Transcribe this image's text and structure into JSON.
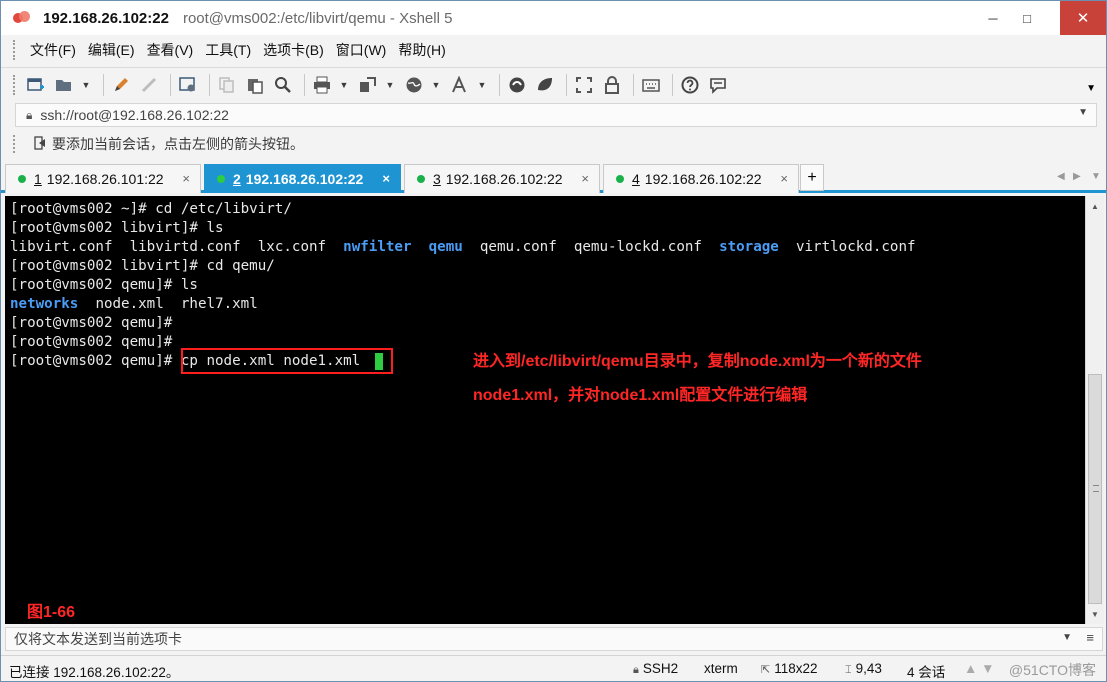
{
  "window": {
    "title_main": "192.168.26.102:22",
    "title_sub": "root@vms002:/etc/libvirt/qemu - Xshell 5",
    "minimize_glyph": "─",
    "maximize_glyph": "□",
    "close_glyph": "✕"
  },
  "menu": {
    "items": [
      "文件(F)",
      "编辑(E)",
      "查看(V)",
      "工具(T)",
      "选项卡(B)",
      "窗口(W)",
      "帮助(H)"
    ]
  },
  "toolbar": {
    "icons": [
      "new-session-icon",
      "open-folder-icon",
      "pencil-icon",
      "disconnect-icon",
      "properties-icon",
      "copy-icon",
      "paste-icon",
      "find-icon",
      "print-icon",
      "transfer-icon",
      "globe-icon",
      "font-icon",
      "xftp-icon",
      "xmanager-icon",
      "fullscreen-icon",
      "lock-icon",
      "keyboard-icon",
      "help-icon",
      "chat-icon"
    ]
  },
  "address": {
    "value": "ssh://root@192.168.26.102:22"
  },
  "hint": {
    "text": "要添加当前会话，点击左侧的箭头按钮。"
  },
  "tabs": [
    {
      "num": "1",
      "label": "192.168.26.101:22",
      "active": false
    },
    {
      "num": "2",
      "label": "192.168.26.102:22",
      "active": true
    },
    {
      "num": "3",
      "label": "192.168.26.102:22",
      "active": false
    },
    {
      "num": "4",
      "label": "192.168.26.102:22",
      "active": false
    }
  ],
  "tab_add": "+",
  "tab_close": "×",
  "terminal": {
    "l1": "[root@vms002 ~]# cd /etc/libvirt/",
    "l2": "[root@vms002 libvirt]# ls",
    "l3": {
      "f1": "libvirt.conf",
      "f2": "libvirtd.conf",
      "f3": "lxc.conf",
      "d1": "nwfilter",
      "d2": "qemu",
      "f4": "qemu.conf",
      "f5": "qemu-lockd.conf",
      "d3": "storage",
      "f6": "virtlockd.conf"
    },
    "l4": "[root@vms002 libvirt]# cd qemu/",
    "l5": "[root@vms002 qemu]# ls",
    "l6": {
      "d1": "networks",
      "f1": "node.xml",
      "f2": "rhel7.xml"
    },
    "l7": "[root@vms002 qemu]#",
    "l8": "[root@vms002 qemu]#",
    "l9_prompt": "[root@vms002 qemu]#",
    "l9_cmd": " cp node.xml node1.xml ",
    "annotation_line1": "进入到/etc/libvirt/qemu目录中，复制node.xml为一个新的文件",
    "annotation_line2": "node1.xml，并对node1.xml配置文件进行编辑",
    "figure_label": "图1-66"
  },
  "compose": {
    "placeholder": "仅将文本发送到当前选项卡"
  },
  "status": {
    "connected": "已连接 192.168.26.102:22。",
    "protocol": "SSH2",
    "terminal_type": "xterm",
    "size": "118x22",
    "cursor_pos": "9,43",
    "sessions": "4 会话",
    "watermark": "@51CTO博客"
  }
}
